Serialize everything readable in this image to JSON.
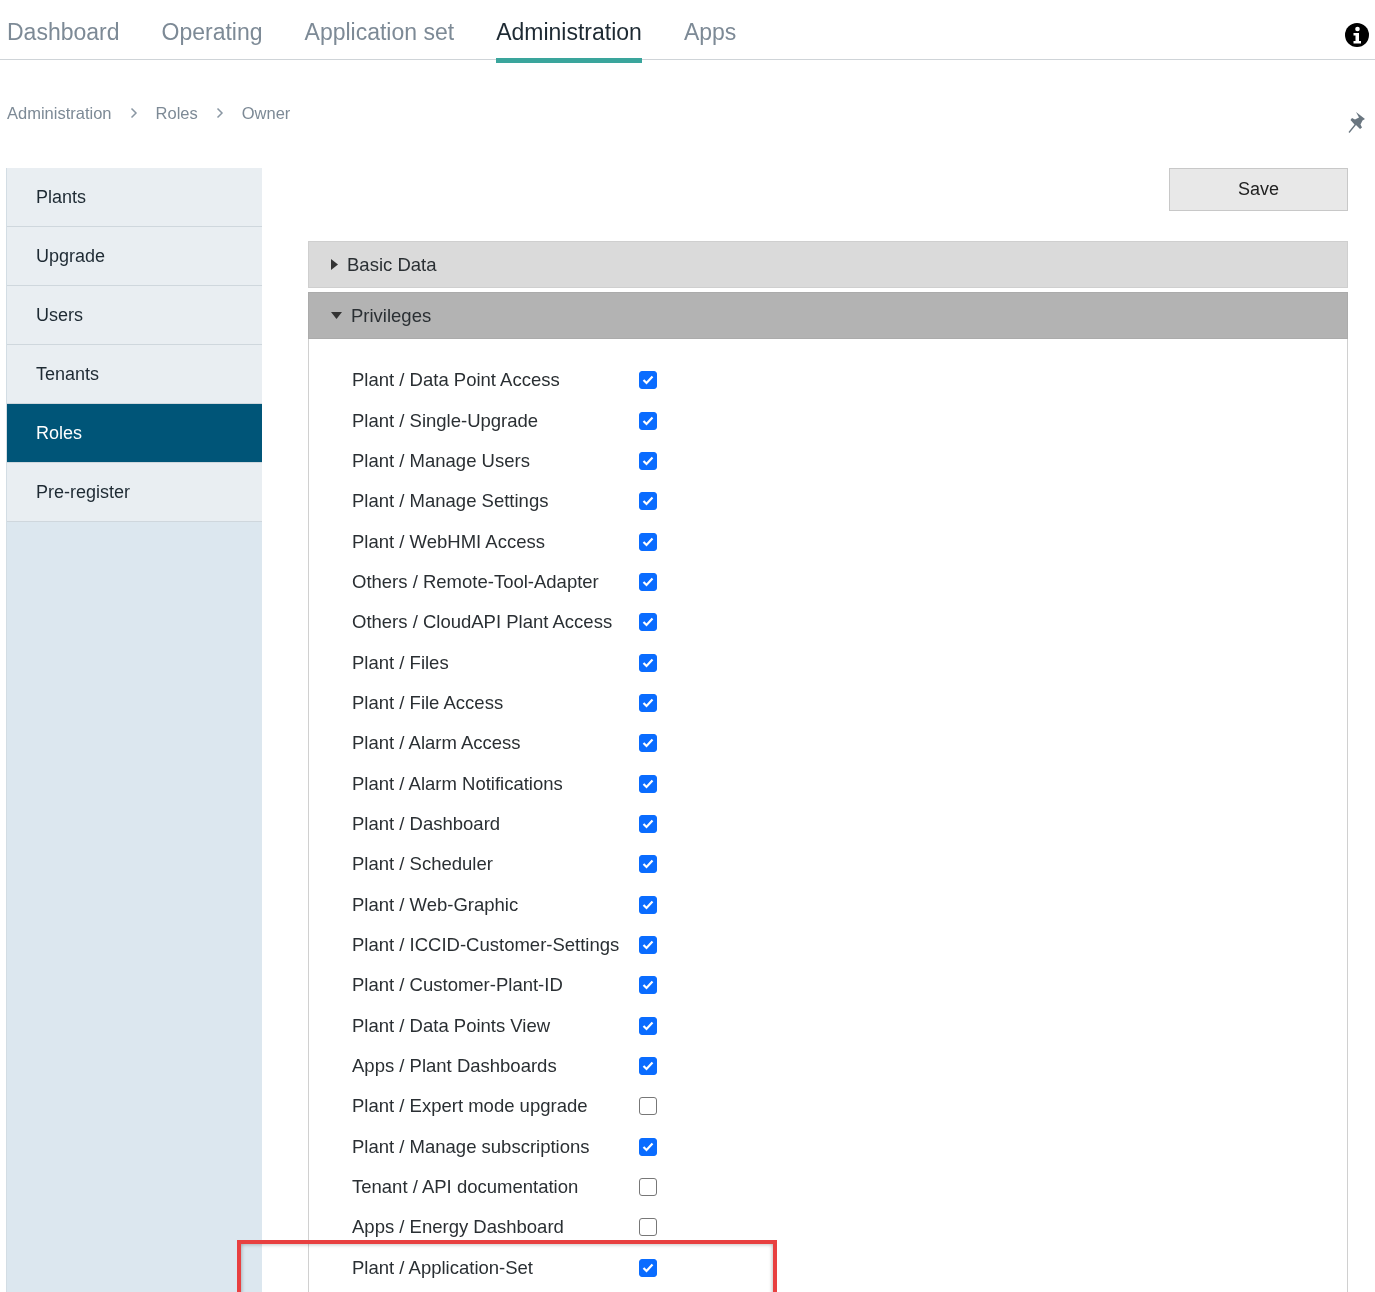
{
  "nav": {
    "tabs": [
      {
        "label": "Dashboard",
        "selected": false
      },
      {
        "label": "Operating",
        "selected": false
      },
      {
        "label": "Application set",
        "selected": false
      },
      {
        "label": "Administration",
        "selected": true
      },
      {
        "label": "Apps",
        "selected": false
      }
    ]
  },
  "breadcrumb": [
    "Administration",
    "Roles",
    "Owner"
  ],
  "sidebar": {
    "items": [
      {
        "label": "Plants",
        "selected": false
      },
      {
        "label": "Upgrade",
        "selected": false
      },
      {
        "label": "Users",
        "selected": false
      },
      {
        "label": "Tenants",
        "selected": false
      },
      {
        "label": "Roles",
        "selected": true
      },
      {
        "label": "Pre-register",
        "selected": false
      }
    ]
  },
  "save_button": "Save",
  "sections": [
    {
      "title": "Basic Data",
      "expanded": false
    },
    {
      "title": "Privileges",
      "expanded": true
    }
  ],
  "privileges": [
    {
      "label": "Plant / Data Point Access",
      "checked": true,
      "highlighted": false
    },
    {
      "label": "Plant / Single-Upgrade",
      "checked": true,
      "highlighted": false
    },
    {
      "label": "Plant / Manage Users",
      "checked": true,
      "highlighted": false
    },
    {
      "label": "Plant / Manage Settings",
      "checked": true,
      "highlighted": false
    },
    {
      "label": "Plant / WebHMI Access",
      "checked": true,
      "highlighted": false
    },
    {
      "label": "Others / Remote-Tool-Adapter",
      "checked": true,
      "highlighted": false
    },
    {
      "label": "Others / CloudAPI Plant Access",
      "checked": true,
      "highlighted": false
    },
    {
      "label": "Plant / Files",
      "checked": true,
      "highlighted": false
    },
    {
      "label": "Plant / File Access",
      "checked": true,
      "highlighted": false
    },
    {
      "label": "Plant / Alarm Access",
      "checked": true,
      "highlighted": false
    },
    {
      "label": "Plant / Alarm Notifications",
      "checked": true,
      "highlighted": false
    },
    {
      "label": "Plant / Dashboard",
      "checked": true,
      "highlighted": false
    },
    {
      "label": "Plant / Scheduler",
      "checked": true,
      "highlighted": false
    },
    {
      "label": "Plant / Web-Graphic",
      "checked": true,
      "highlighted": false
    },
    {
      "label": "Plant / ICCID-Customer-Settings",
      "checked": true,
      "highlighted": false
    },
    {
      "label": "Plant / Customer-Plant-ID",
      "checked": true,
      "highlighted": false
    },
    {
      "label": "Plant / Data Points View",
      "checked": true,
      "highlighted": false
    },
    {
      "label": "Apps / Plant Dashboards",
      "checked": true,
      "highlighted": false
    },
    {
      "label": "Plant / Expert mode upgrade",
      "checked": false,
      "highlighted": false
    },
    {
      "label": "Plant / Manage subscriptions",
      "checked": true,
      "highlighted": false
    },
    {
      "label": "Tenant / API documentation",
      "checked": false,
      "highlighted": false
    },
    {
      "label": "Apps / Energy Dashboard",
      "checked": false,
      "highlighted": false
    },
    {
      "label": "Plant / Application-Set",
      "checked": true,
      "highlighted": true
    }
  ]
}
